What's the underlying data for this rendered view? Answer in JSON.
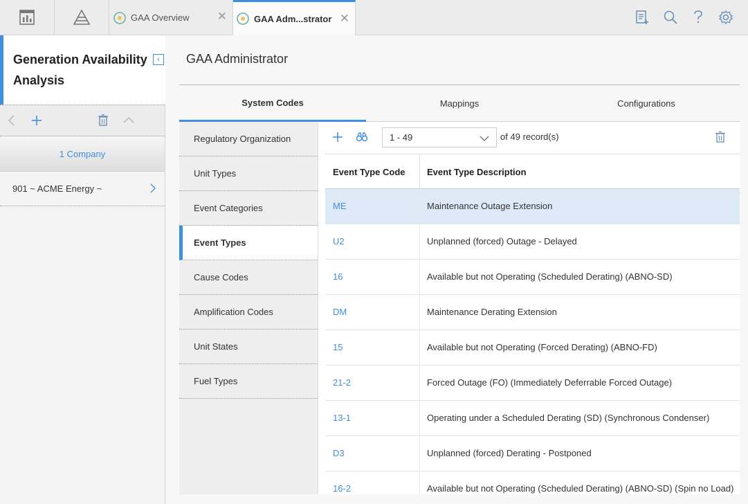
{
  "topbar": {
    "tabs": [
      {
        "label": "GAA Overview",
        "active": false
      },
      {
        "label": "GAA Adm...strator",
        "active": true
      }
    ],
    "left_icons": [
      "dashboard-icon",
      "pyramid-icon"
    ],
    "right_icons": [
      "new-record-icon",
      "search-icon",
      "help-icon",
      "settings-icon"
    ]
  },
  "left_panel": {
    "title": "Generation Availability Analysis",
    "section_label": "1 Company",
    "items": [
      {
        "label": "901 ~ ACME Energy ~"
      }
    ]
  },
  "main": {
    "title": "GAA Administrator",
    "subtabs": [
      {
        "label": "System Codes",
        "active": true
      },
      {
        "label": "Mappings",
        "active": false
      },
      {
        "label": "Configurations",
        "active": false
      }
    ],
    "code_categories": [
      {
        "label": "Regulatory Organization",
        "active": false
      },
      {
        "label": "Unit Types",
        "active": false
      },
      {
        "label": "Event Categories",
        "active": false
      },
      {
        "label": "Event Types",
        "active": true
      },
      {
        "label": "Cause Codes",
        "active": false
      },
      {
        "label": "Amplification Codes",
        "active": false
      },
      {
        "label": "Unit States",
        "active": false
      },
      {
        "label": "Fuel Types",
        "active": false
      }
    ],
    "grid": {
      "range": "1 - 49",
      "of_label": "of",
      "total": "49",
      "records_label": "record(s)",
      "columns": [
        "Event Type Code",
        "Event Type Description"
      ],
      "rows": [
        {
          "code": "ME",
          "description": "Maintenance Outage Extension",
          "selected": true
        },
        {
          "code": "U2",
          "description": "Unplanned (forced) Outage - Delayed",
          "selected": false
        },
        {
          "code": "16",
          "description": "Available but not Operating (Scheduled Derating) (ABNO-SD)",
          "selected": false
        },
        {
          "code": "DM",
          "description": "Maintenance Derating Extension",
          "selected": false
        },
        {
          "code": "15",
          "description": "Available but not Operating (Forced Derating) (ABNO-FD)",
          "selected": false
        },
        {
          "code": "21-2",
          "description": "Forced Outage (FO) (Immediately Deferrable Forced Outage)",
          "selected": false
        },
        {
          "code": "13-1",
          "description": "Operating under a Scheduled Derating (SD) (Synchronous Condenser)",
          "selected": false
        },
        {
          "code": "D3",
          "description": "Unplanned (forced) Derating - Postponed",
          "selected": false
        },
        {
          "code": "16-2",
          "description": "Available but not Operating (Scheduled Derating) (ABNO-SD) (Spin no Load)",
          "selected": false
        }
      ]
    }
  },
  "colors": {
    "accent": "#3f8fe0",
    "selected_row": "#dde9f7"
  }
}
